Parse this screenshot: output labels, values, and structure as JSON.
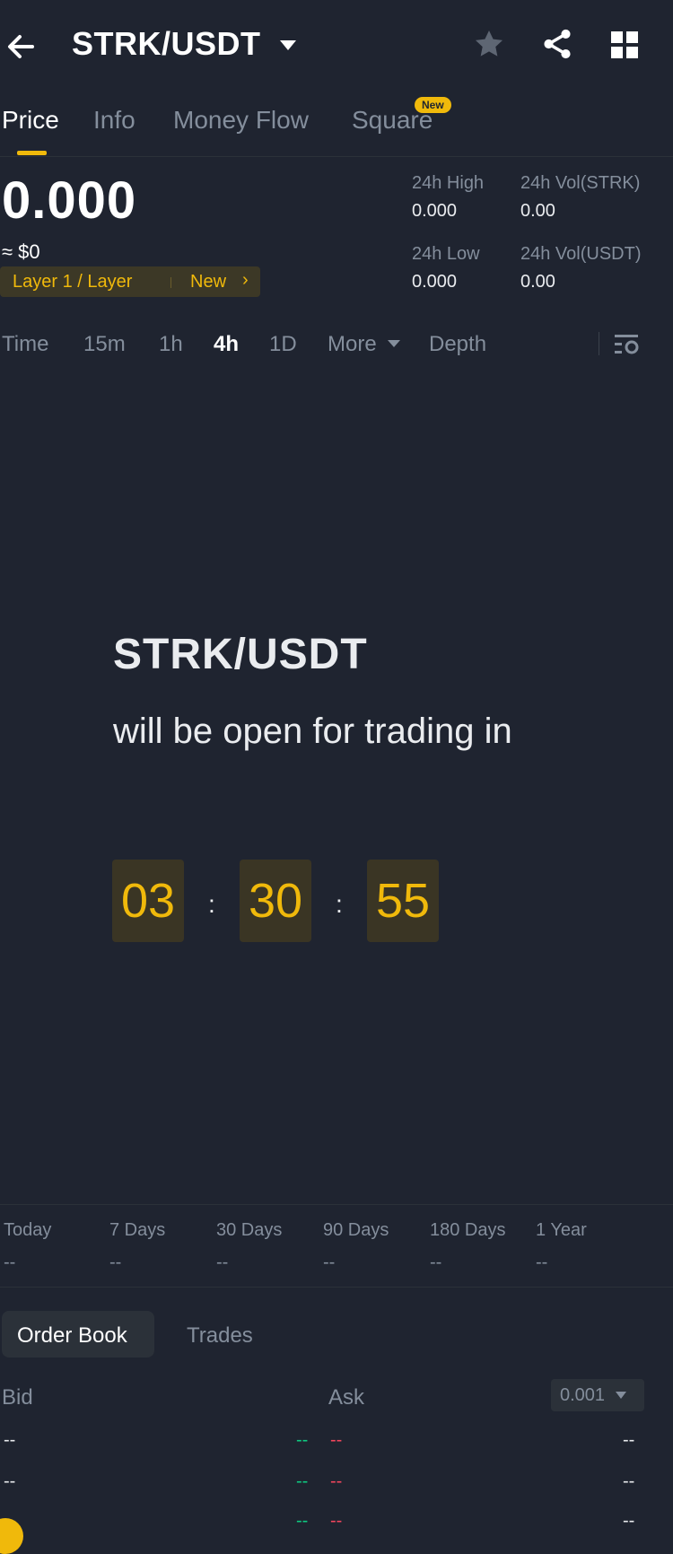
{
  "header": {
    "pair": "STRK/USDT",
    "icons": [
      "back-arrow-icon",
      "caret-down-icon",
      "star-icon",
      "share-icon",
      "grid-icon"
    ]
  },
  "tabs": [
    {
      "label": "Price",
      "active": true
    },
    {
      "label": "Info"
    },
    {
      "label": "Money Flow"
    },
    {
      "label": "Square",
      "badge": "New"
    }
  ],
  "price": {
    "last": "0.000",
    "usd": "≈ $0",
    "tag_category": "Layer 1 / Layer",
    "tag_new": "New",
    "tag_chevron": "›"
  },
  "stats": {
    "high_label": "24h High",
    "high_value": "0.000",
    "vol_base_label": "24h Vol(STRK)",
    "vol_base_value": "0.00",
    "low_label": "24h Low",
    "low_value": "0.000",
    "vol_quote_label": "24h Vol(USDT)",
    "vol_quote_value": "0.00"
  },
  "intervals": {
    "items": [
      "Time",
      "15m",
      "1h",
      "4h",
      "1D",
      "More",
      "Depth"
    ],
    "selected": "4h"
  },
  "countdown": {
    "title": "STRK/USDT",
    "subtitle": "will be open for trading in",
    "hours": "03",
    "minutes": "30",
    "seconds": "55",
    "separator": ":"
  },
  "performance": [
    {
      "label": "Today",
      "value": "--"
    },
    {
      "label": "7 Days",
      "value": "--"
    },
    {
      "label": "30 Days",
      "value": "--"
    },
    {
      "label": "90 Days",
      "value": "--"
    },
    {
      "label": "180 Days",
      "value": "--"
    },
    {
      "label": "1 Year",
      "value": "--"
    }
  ],
  "order_book": {
    "tab_active": "Order Book",
    "tab_other": "Trades",
    "bid_label": "Bid",
    "ask_label": "Ask",
    "precision": "0.001",
    "placeholder": "--"
  },
  "colors": {
    "accent": "#f0b90b",
    "bid": "#0ecb81",
    "ask": "#f6465d",
    "background": "#1f2430"
  }
}
